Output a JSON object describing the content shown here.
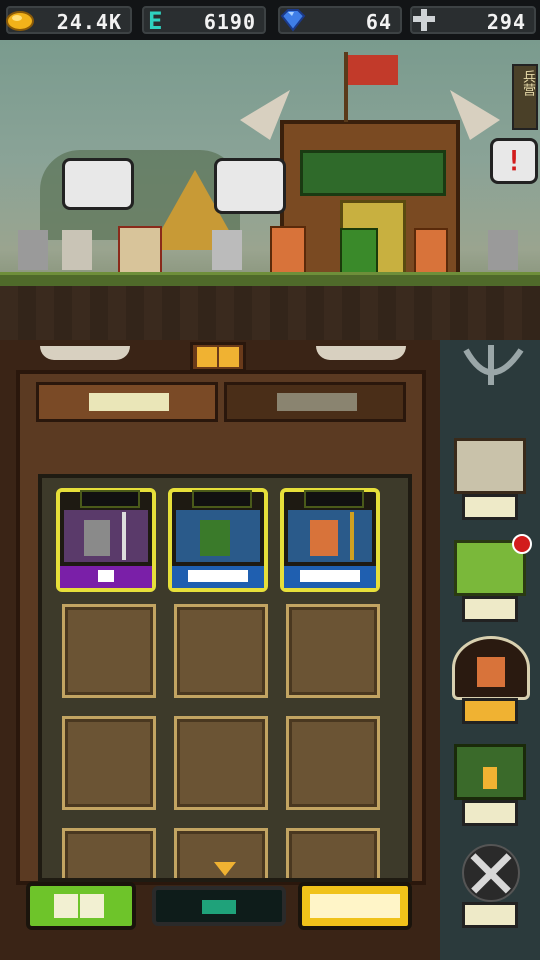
{
  "resources": {
    "gold": "24.4K",
    "essence": "6190",
    "gems": "64",
    "population": "294"
  },
  "scene": {
    "building_sign": "兵营",
    "speech_alert": "!"
  },
  "icons": {
    "gold": "gold-coin-icon",
    "essence": "essence-e-icon",
    "gem": "blue-gem-icon",
    "population": "cross-icon",
    "scroll_down": "triangle-down-icon"
  },
  "colors": {
    "card_border": "#e6df3a",
    "common_footer": "#7a1fa8",
    "rare_footer": "#1f5fb0",
    "green_button": "#6ec42a",
    "yellow_button": "#f0c21a",
    "center_indicator": "#1fa27a"
  }
}
